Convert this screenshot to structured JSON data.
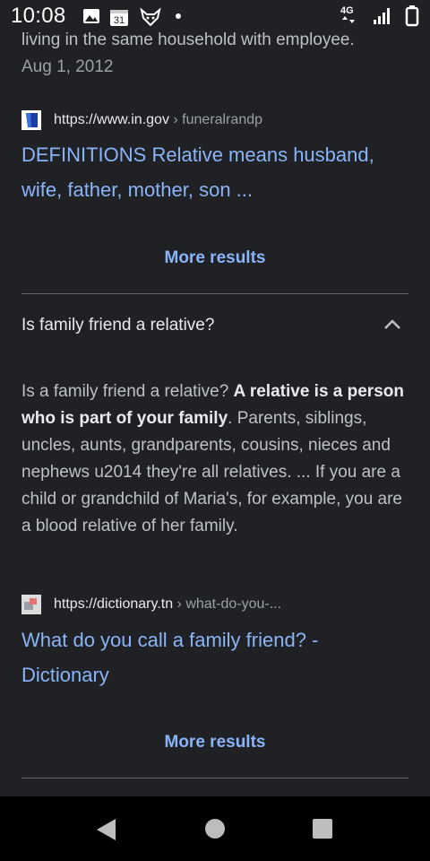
{
  "status": {
    "time": "10:08",
    "network": "4G"
  },
  "prev_snippet": {
    "tail_text": "living in the same household with employee.",
    "date": "Aug 1, 2012"
  },
  "result1": {
    "url": "https://www.in.gov",
    "crumb": " › funeralrandp",
    "title_line1": "DEFINITIONS Relative means husband,",
    "title_line2": "wife, father, mother, son ..."
  },
  "more_results_1": "More results",
  "question": {
    "text": "Is family friend a relative?",
    "expanded": true
  },
  "answer": {
    "part1": "Is a family friend a relative? ",
    "bold": "A relative is a person who is part of your family",
    "part2": ". Parents, siblings, uncles, aunts, grandparents, cousins, nieces and nephews u2014 they're all relatives. ... If you are a child or grandchild of Maria's, for example, you are a blood relative of her family."
  },
  "result2": {
    "url": "https://dictionary.tn",
    "crumb": " › what-do-you-...",
    "title_line1": "What do you call a family friend? -",
    "title_line2": "Dictionary"
  },
  "more_results_2": "More results",
  "colors": {
    "background": "#202124",
    "link": "#8ab4f8",
    "text": "#bdc1c6",
    "divider": "#5f6368"
  },
  "icons": [
    "image-icon",
    "calendar-icon",
    "fox-icon",
    "dot-icon",
    "signal-icon",
    "battery-icon",
    "chevron-up-icon",
    "back-icon",
    "home-icon",
    "recents-icon"
  ]
}
